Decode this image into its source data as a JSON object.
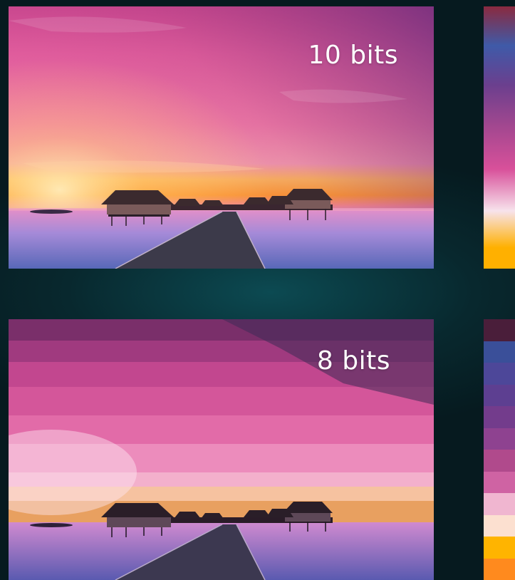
{
  "top_panel": {
    "label": "10 bits"
  },
  "bottom_panel": {
    "label": "8 bits"
  },
  "gradient_top": [
    "#8a2a3f",
    "#3f5aa8",
    "#6b3f8e",
    "#a0478f",
    "#d8509a",
    "#f7e3ec",
    "#ffb000"
  ],
  "bands_bottom": [
    "#4a1e3a",
    "#3a4f99",
    "#4d4799",
    "#5d3f91",
    "#733c8c",
    "#8e4290",
    "#b04a8c",
    "#cf63a3",
    "#f0b6d0",
    "#fce0d0",
    "#ffb400",
    "#ff8a1e"
  ]
}
